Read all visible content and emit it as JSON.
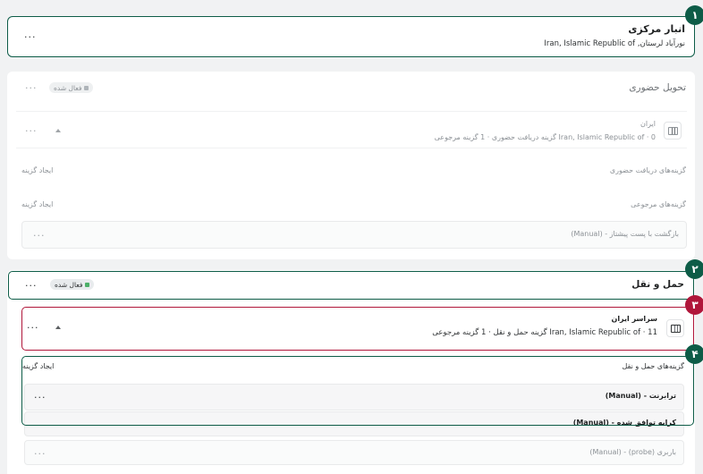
{
  "warehouse": {
    "title": "انبار مرکزی",
    "address_line": "نورآباد لرستان, Iran, Islamic Republic of"
  },
  "pickup": {
    "title": "تحویل حضوری",
    "status_badge": "فعال شده",
    "zone": {
      "name": "ایران",
      "summary": "Iran, Islamic Republic of  ·  0 گزینه دریافت حضوری  ·  1 گزینه مرجوعی"
    },
    "options_heading": "گزینه‌های دریافت حضوری",
    "options_create": "ایجاد گزینه",
    "returns_heading": "گزینه‌های مرجوعی",
    "returns_create": "ایجاد گزینه",
    "return_option": "بازگشت با پست پیشتاز - (Manual)"
  },
  "shipping": {
    "title": "حمل و نقل",
    "status_badge": "فعال شده",
    "zone": {
      "name": "سراسر ایران",
      "summary": "Iran, Islamic Republic of  ·  11 گزینه حمل و نقل  ·  1 گزینه مرجوعی"
    },
    "options_heading": "گزینه‌های حمل و نقل",
    "options_create": "ایجاد گزینه",
    "rates": [
      "ترابرنت - (Manual)",
      "کرایه توافق شده - (Manual)",
      "باربری (probe) - (Manual)"
    ]
  },
  "callouts": [
    "۱",
    "۲",
    "۳",
    "۴"
  ],
  "menu_glyph": "···",
  "colors": {
    "green_callout": "#0d5c47",
    "red_callout": "#b0163a",
    "badge_green": "#4caf68"
  }
}
